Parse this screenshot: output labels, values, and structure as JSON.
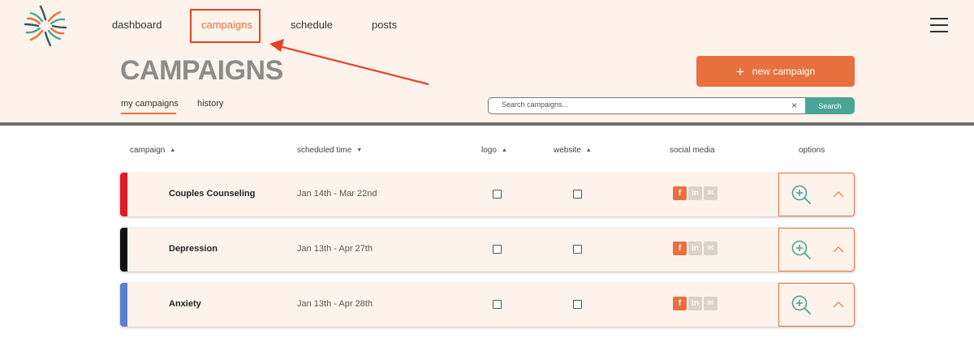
{
  "nav": {
    "items": [
      {
        "label": "dashboard"
      },
      {
        "label": "campaigns",
        "active": true
      },
      {
        "label": "schedule"
      },
      {
        "label": "posts"
      }
    ]
  },
  "page": {
    "title": "CAMPAIGNS",
    "subtabs": [
      {
        "label": "my campaigns",
        "active": true
      },
      {
        "label": "history"
      }
    ]
  },
  "actions": {
    "new_campaign_label": "new campaign",
    "new_campaign_icon": "plus-icon"
  },
  "search": {
    "placeholder": "Search campaigns...",
    "clear_label": "×",
    "button_label": "Search"
  },
  "table": {
    "columns": [
      "campaign",
      "scheduled time",
      "logo",
      "website",
      "social media",
      "options"
    ],
    "rows": [
      {
        "name": "Couples Counseling",
        "dates": "Jan 14th - Mar 22nd",
        "stripe_color": "#e01b24",
        "logo": false,
        "website": false
      },
      {
        "name": "Depression",
        "dates": "Jan 13th - Apr 27th",
        "stripe_color": "#111111",
        "logo": false,
        "website": false
      },
      {
        "name": "Anxiety",
        "dates": "Jan 13th - Apr 28th",
        "stripe_color": "#5b7fcf",
        "logo": false,
        "website": false
      }
    ],
    "social_icons": [
      "facebook-icon",
      "linkedin-icon",
      "twitter-icon"
    ]
  },
  "colors": {
    "accent": "#e8703f",
    "teal": "#4aa597",
    "header_bg": "#fdf3ea",
    "annotation": "#e8402a"
  }
}
